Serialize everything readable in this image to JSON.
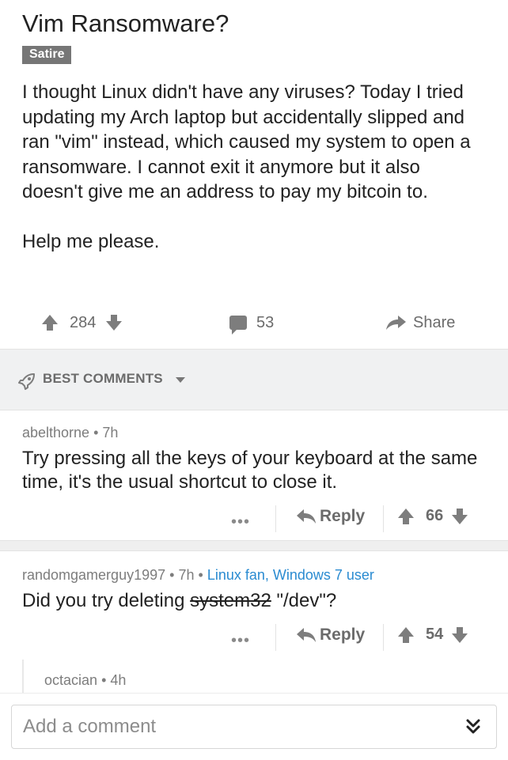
{
  "post": {
    "title": "Vim Ransomware?",
    "flair": "Satire",
    "body_p1": "I thought Linux didn't have any viruses? Today I tried updating my Arch laptop but accidentally slipped and ran \"vim\" instead, which caused my system to open a ransomware. I cannot exit it anymore but it also doesn't give me an address to pay my bitcoin to.",
    "body_p2": "Help me please.",
    "score": "284",
    "comment_count": "53",
    "share_label": "Share"
  },
  "sort": {
    "label": "BEST COMMENTS"
  },
  "comments": [
    {
      "author": "abelthorne",
      "age": "7h",
      "flair": "",
      "text": "Try pressing all the keys of your keyboard at the same time, it's the usual shortcut to close it.",
      "reply_label": "Reply",
      "score": "66"
    },
    {
      "author": "randomgamerguy1997",
      "age": "7h",
      "flair": "Linux fan, Windows 7 user",
      "text_before": "Did you try deleting ",
      "text_strike": "system32",
      "text_after": " \"/dev\"?",
      "reply_label": "Reply",
      "score": "54"
    },
    {
      "author": "octacian",
      "age": "4h"
    }
  ],
  "composer": {
    "placeholder": "Add a comment"
  },
  "colors": {
    "accent_link": "#2a8bd1",
    "icon_gray": "#7d7d7d",
    "bar_bg": "#f0f1f2"
  },
  "icons": [
    "upvote-icon",
    "downvote-icon",
    "comment-bubble-icon",
    "share-arrow-icon",
    "rocket-icon",
    "chevron-down-icon",
    "reply-icon",
    "more-dots-icon",
    "double-chevron-down-icon"
  ]
}
